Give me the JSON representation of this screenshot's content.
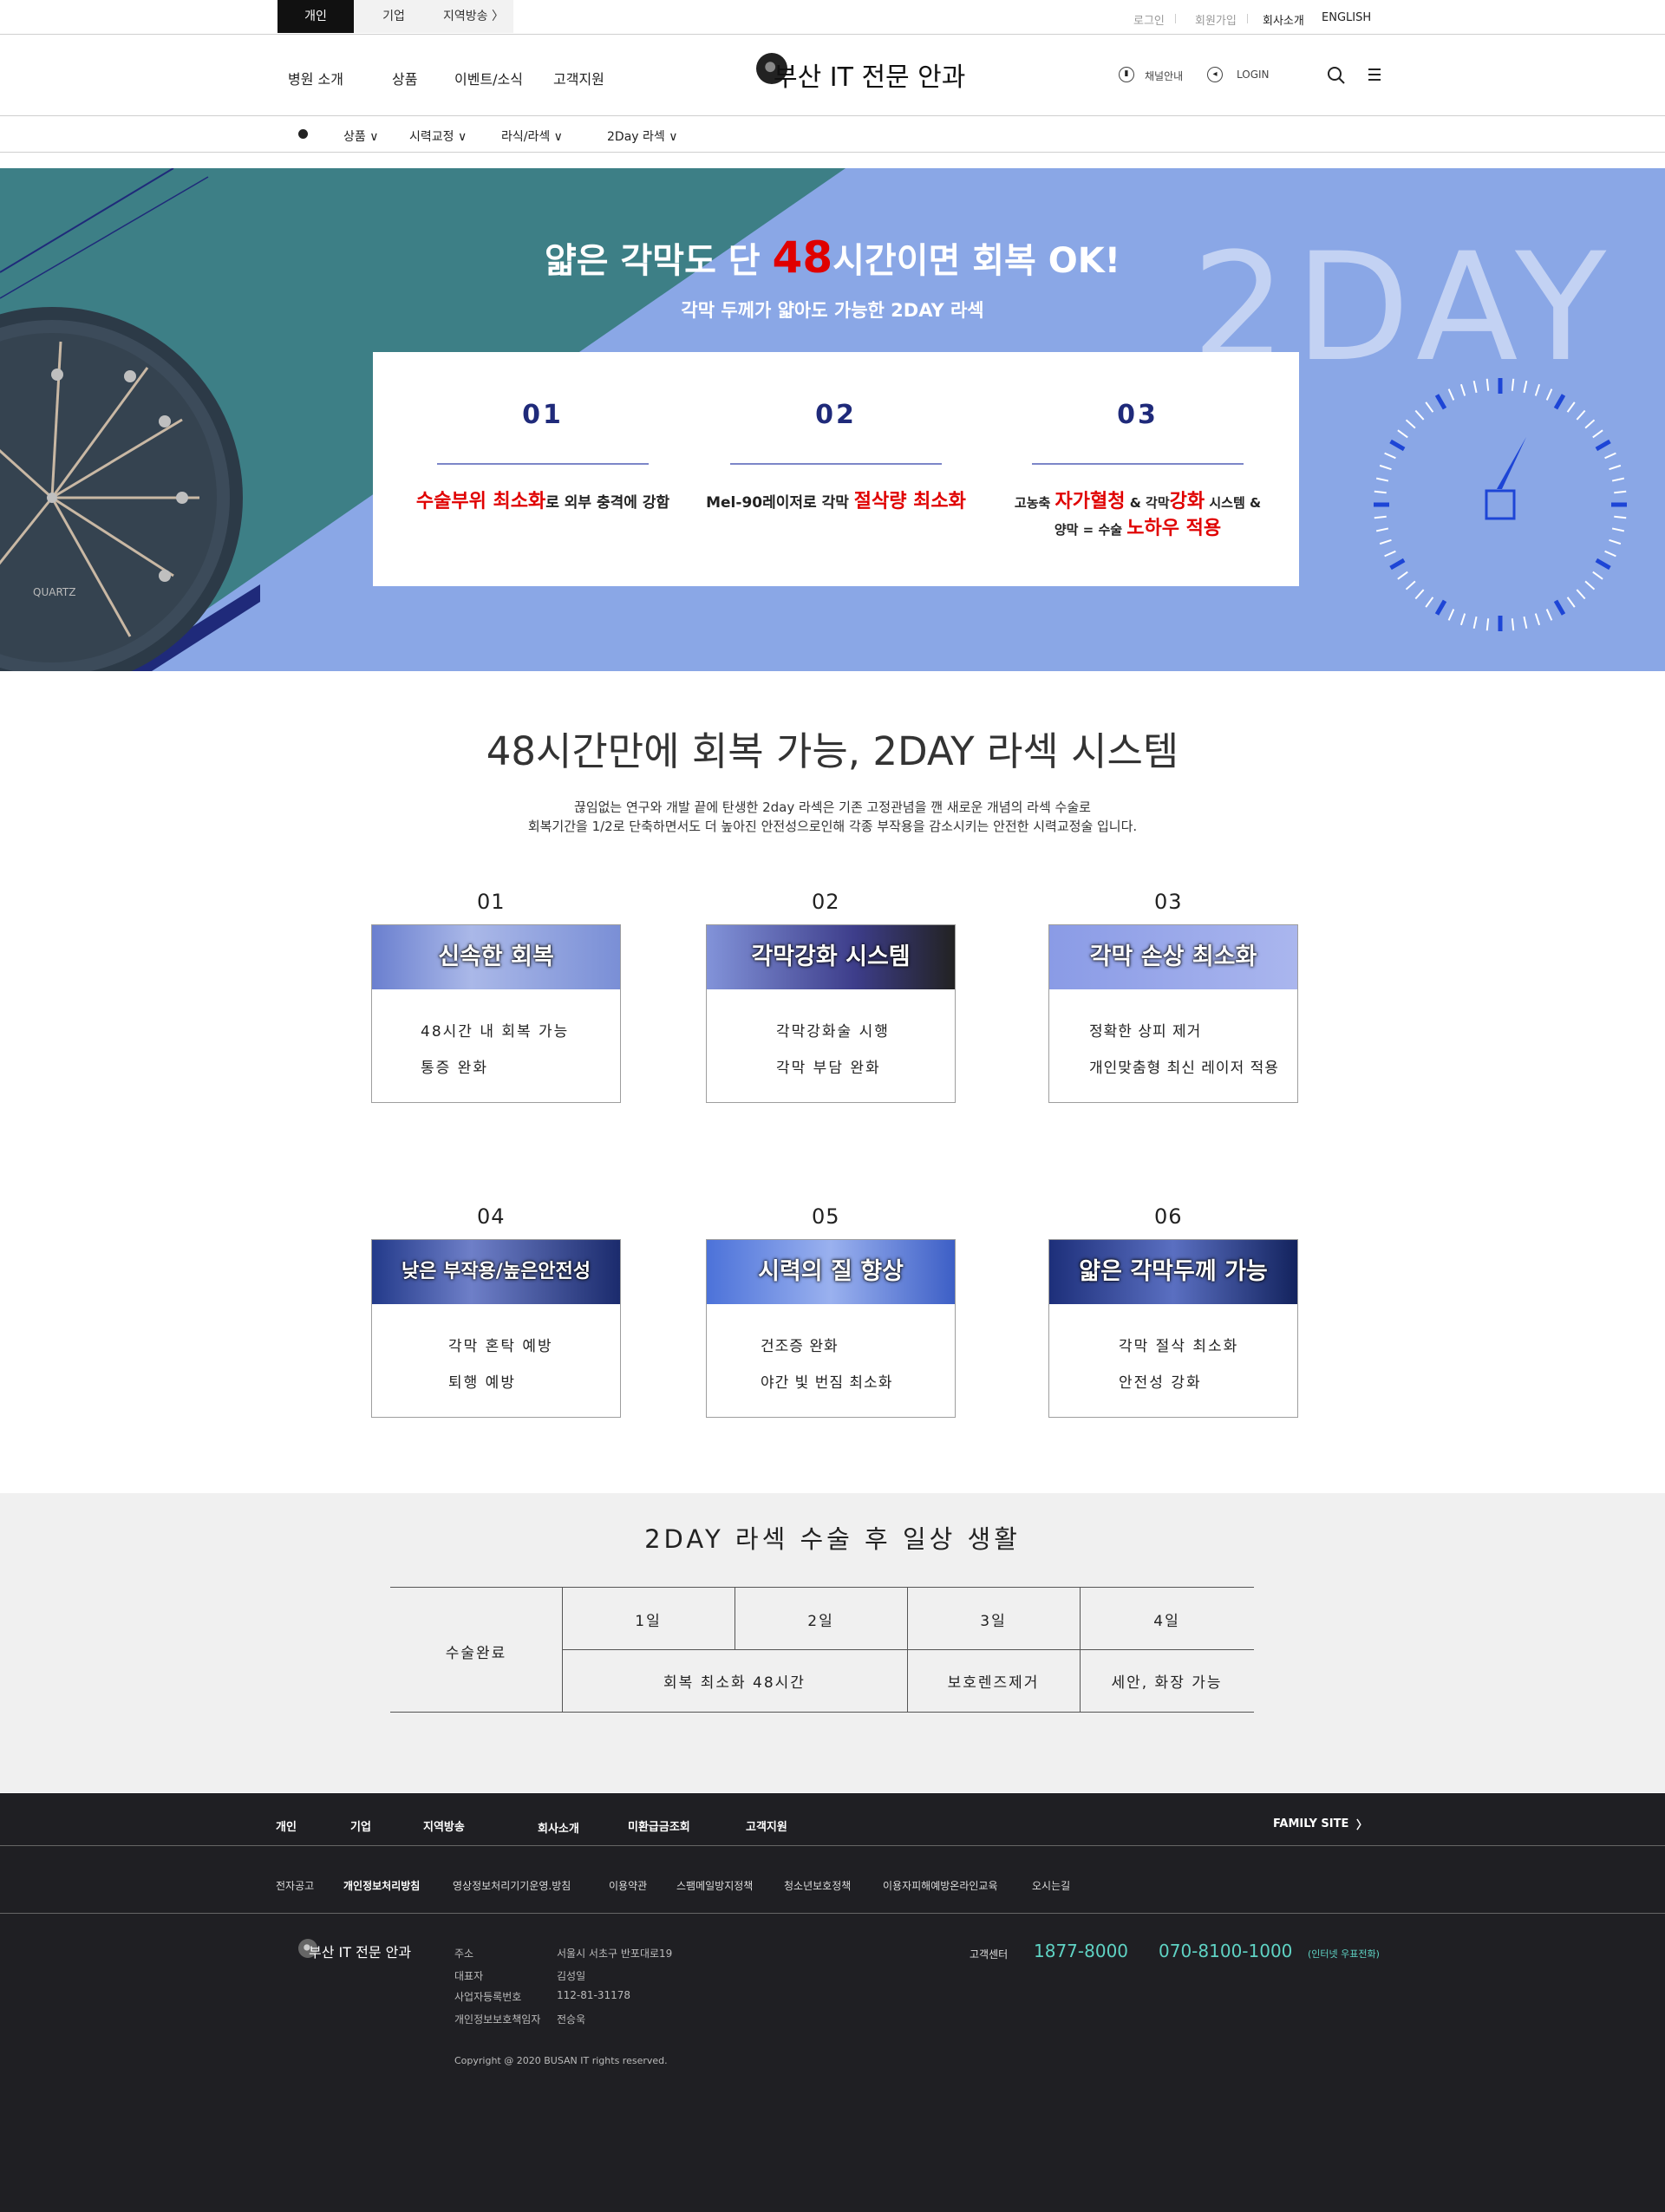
{
  "topbar": {
    "tabs": [
      "개인",
      "기업",
      "지역방송 〉"
    ],
    "links": [
      "로그인",
      "회원가입",
      "회사소개",
      "ENGLISH"
    ]
  },
  "header": {
    "gnb": [
      "병원 소개",
      "상품",
      "이벤트/소식",
      "고객지원"
    ],
    "logo": "부산 IT 전문 안과",
    "channel": "채널안내",
    "login": "LOGIN"
  },
  "subnav": {
    "items": [
      "상품 ∨",
      "시력교정 ∨",
      "라식/라섹 ∨",
      "2Day 라섹 ∨"
    ]
  },
  "hero": {
    "title_pre": "얇은 각막도 단 ",
    "title_num": "48",
    "title_post": "시간이면 회복 OK!",
    "subtitle": "각막 두께가 얇아도 가능한 2DAY 라섹",
    "big_text": "2DAY",
    "clock_brand": "QUARTZ",
    "cards": [
      {
        "num": "01",
        "l1_red": "수술부위 최소화",
        "l1": "로 외부 충격에 강함"
      },
      {
        "num": "02",
        "l1": "Mel-90레이저로 각막 ",
        "l1_red": "절삭량 최소화"
      },
      {
        "num": "03",
        "l1a": "고농축 ",
        "l1b_red": "자가혈청",
        "l1c": " & 각막",
        "l1d_red": "강화",
        "l1e": " 시스템 &",
        "l2a": "양막 = 수술 ",
        "l2b_red": "노하우 적용"
      }
    ]
  },
  "features": {
    "title": "48시간만에 회복 가능, 2DAY 라섹 시스템",
    "desc1": "끊임없는 연구와 개발 끝에 탄생한 2day 라섹은 기존 고정관념을 깬 새로운 개념의 라섹 수술로",
    "desc2": "회복기간을 1/2로 단축하면서도 더 높아진 안전성으로인해 각종 부작용을 감소시키는 안전한 시력교정술 입니다.",
    "items": [
      {
        "num": "01",
        "head": "신속한 회복",
        "lines": [
          "48시간 내 회복 가능",
          "통증 완화"
        ]
      },
      {
        "num": "02",
        "head": "각막강화 시스템",
        "lines": [
          "각막강화술 시행",
          "각막 부담 완화"
        ]
      },
      {
        "num": "03",
        "head": "각막 손상 최소화",
        "lines": [
          "정확한 상피 제거",
          "개인맞춤형 최신 레이저 적용"
        ]
      },
      {
        "num": "04",
        "head": "낮은 부작용/높은안전성",
        "lines": [
          "각막 혼탁 예방",
          "퇴행 예방"
        ]
      },
      {
        "num": "05",
        "head": "시력의 질 향상",
        "lines": [
          "건조증 완화",
          "야간 빛 번짐 최소화"
        ]
      },
      {
        "num": "06",
        "head": "얇은 각막두께 가능",
        "lines": [
          "각막 절삭 최소화",
          "안전성 강화"
        ]
      }
    ]
  },
  "daily": {
    "title": "2DAY 라섹 수술 후 일상 생활",
    "left": "수술완료",
    "days": [
      "1일",
      "2일",
      "3일",
      "4일"
    ],
    "row2": [
      "회복 최소화 48시간",
      "보호렌즈제거",
      "세안, 화장 가능"
    ]
  },
  "footer": {
    "nav1": [
      "개인",
      "기업",
      "지역방송",
      "회사소개",
      "미환급금조회",
      "고객지원"
    ],
    "family": "FAMILY SITE",
    "nav2": [
      "전자공고",
      "개인정보처리방침",
      "영상정보처리기기운영.방침",
      "이용약관",
      "스팸메일방지정책",
      "청소년보호정책",
      "이용자피해예방온라인교육",
      "오시는길"
    ],
    "logo": "부산 IT 전문 안과",
    "info_labels": [
      "주소",
      "대표자",
      "사업자등록번호",
      "개인정보보호책임자"
    ],
    "info_values": [
      "서울시 서초구 반포대로19",
      "김성일",
      "112-81-31178",
      "전승욱"
    ],
    "copyright": "Copyright @ 2020 BUSAN IT rights reserved.",
    "cs_label": "고객센터",
    "cs1": "1877-8000",
    "cs2": "070-8100-1000",
    "cs_note": "(인터넷 우표전화)"
  },
  "colors": {
    "hero_bg": "#8aa7e6",
    "teal": "#3d7f86",
    "navy": "#1f2a7a",
    "red": "#e00000",
    "footer_bg": "#1f1f23",
    "mint": "#5fd3c4"
  }
}
